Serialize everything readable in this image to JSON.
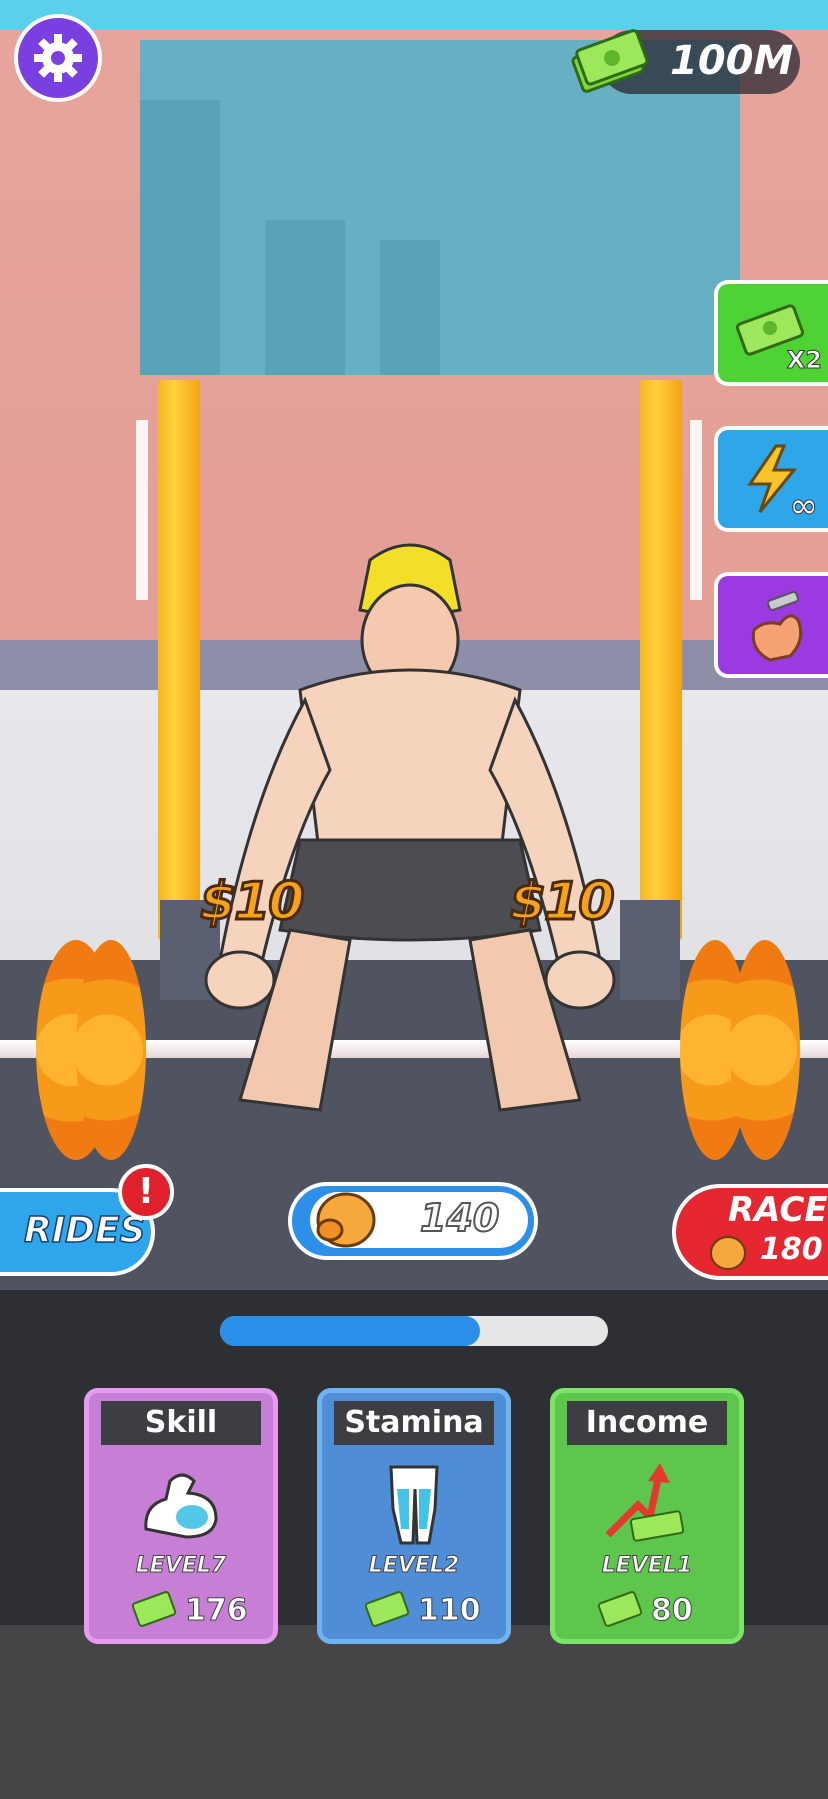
{
  "hud": {
    "money": "100M",
    "settings_icon": "gear-icon"
  },
  "side_buttons": [
    {
      "name": "double-money-button",
      "badge": "X2",
      "icon": "cash-stack-icon",
      "color": "#4fd234"
    },
    {
      "name": "infinite-energy-button",
      "badge": "∞",
      "icon": "lightning-icon",
      "color": "#2ea6ea"
    },
    {
      "name": "strength-boost-button",
      "badge": "",
      "icon": "dumbbell-arm-icon",
      "color": "#9b3ae0"
    }
  ],
  "scene": {
    "price_left": "$10",
    "price_right": "$10"
  },
  "rides": {
    "label": "RIDES",
    "alert": "!"
  },
  "strength": {
    "value": "140",
    "icon": "boxing-glove-icon"
  },
  "race": {
    "label": "RACE",
    "value": "180"
  },
  "progress": {
    "fraction": 0.67
  },
  "upgrades": [
    {
      "title": "Skill",
      "level": "LEVEL7",
      "cost": "176",
      "icon": "flexed-arm-icon",
      "bg": "#c77fd5",
      "border": "#e79bef"
    },
    {
      "title": "Stamina",
      "level": "LEVEL2",
      "cost": "110",
      "icon": "legs-icon",
      "bg": "#4f8ed6",
      "border": "#6fb3f3"
    },
    {
      "title": "Income",
      "level": "LEVEL1",
      "cost": "80",
      "icon": "income-arrow-icon",
      "bg": "#5ec54d",
      "border": "#7fe36a"
    }
  ],
  "colors": {
    "accent_blue": "#2a8fe8",
    "race_red": "#e42730"
  }
}
